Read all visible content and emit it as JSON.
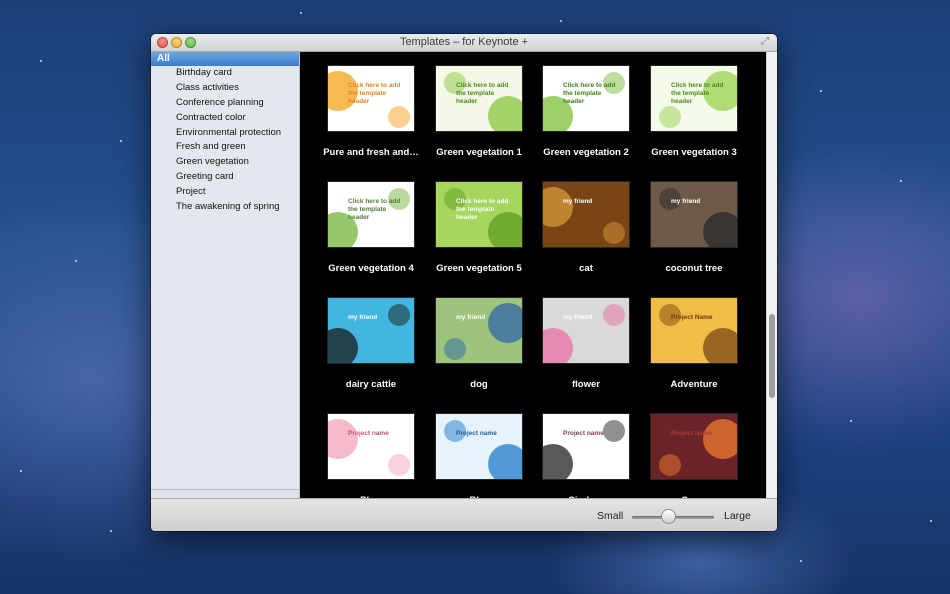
{
  "window": {
    "title": "Templates – for Keynote +"
  },
  "sidebar": {
    "selected": "All",
    "items": [
      "Birthday card",
      "Class activities",
      "Conference planning",
      "Contracted color",
      "Environmental protection",
      "Fresh and green",
      "Green vegetation",
      "Greeting card",
      "Project",
      "The awakening of spring"
    ]
  },
  "templates": [
    {
      "label": "Pure and fresh and…",
      "bg": "#ffffff",
      "accent": "#f4a21b",
      "text": "Click here to add the template header",
      "textColor": "#e0871a"
    },
    {
      "label": "Green vegetation 1",
      "bg": "#f3f9e6",
      "accent": "#8cc63f",
      "text": "Click here to add the template header",
      "textColor": "#4a8a1e"
    },
    {
      "label": "Green vegetation 2",
      "bg": "#ffffff",
      "accent": "#7cbf3a",
      "text": "Click here to add the template header",
      "textColor": "#3f7f1a"
    },
    {
      "label": "Green vegetation 3",
      "bg": "#f4fbe9",
      "accent": "#9ad14f",
      "text": "Click here to add the template header",
      "textColor": "#4a8a1e"
    },
    {
      "label": "Green vegetation 4",
      "bg": "#ffffff",
      "accent": "#73b63a",
      "text": "Click here to add the template header",
      "textColor": "#567a3a"
    },
    {
      "label": "Green vegetation 5",
      "bg": "#a6d65e",
      "accent": "#5f9e24",
      "text": "Click here to add the template header",
      "textColor": "#ffffff"
    },
    {
      "label": "cat",
      "bg": "#7a4515",
      "accent": "#d79a3c",
      "text": "my friend",
      "textColor": "#ffffff"
    },
    {
      "label": "coconut tree",
      "bg": "#6e5a48",
      "accent": "#2a2a2a",
      "text": "my friend",
      "textColor": "#ffffff"
    },
    {
      "label": "dairy cattle",
      "bg": "#41b6e0",
      "accent": "#1b1b1b",
      "text": "my friend",
      "textColor": "#ffffff"
    },
    {
      "label": "dog",
      "bg": "#9ec37c",
      "accent": "#2d6aa8",
      "text": "my friend",
      "textColor": "#ffffff"
    },
    {
      "label": "flower",
      "bg": "#d9d9d9",
      "accent": "#e86fa3",
      "text": "my friend",
      "textColor": "#ffffff"
    },
    {
      "label": "Adventure",
      "bg": "#f2bd45",
      "accent": "#7a4a14",
      "text": "Project Name",
      "textColor": "#6a3a0c"
    },
    {
      "label": "Ph…",
      "bg": "#ffffff",
      "accent": "#f3a3b6",
      "text": "Project name",
      "textColor": "#c0546a"
    },
    {
      "label": "Bl…",
      "bg": "#e6f3fb",
      "accent": "#1f7cc9",
      "text": "Project name",
      "textColor": "#1a5f9a"
    },
    {
      "label": "Circle…",
      "bg": "#ffffff",
      "accent": "#222222",
      "text": "Project name",
      "textColor": "#7a3a5a"
    },
    {
      "label": "Cro…",
      "bg": "#6a2427",
      "accent": "#ef7a2e",
      "text": "Project name",
      "textColor": "#b03a3a"
    }
  ],
  "footer": {
    "small_label": "Small",
    "large_label": "Large",
    "size_value": 0.45
  },
  "colors": {
    "selection": "#3e7cc9",
    "grid_background": "#000000"
  }
}
